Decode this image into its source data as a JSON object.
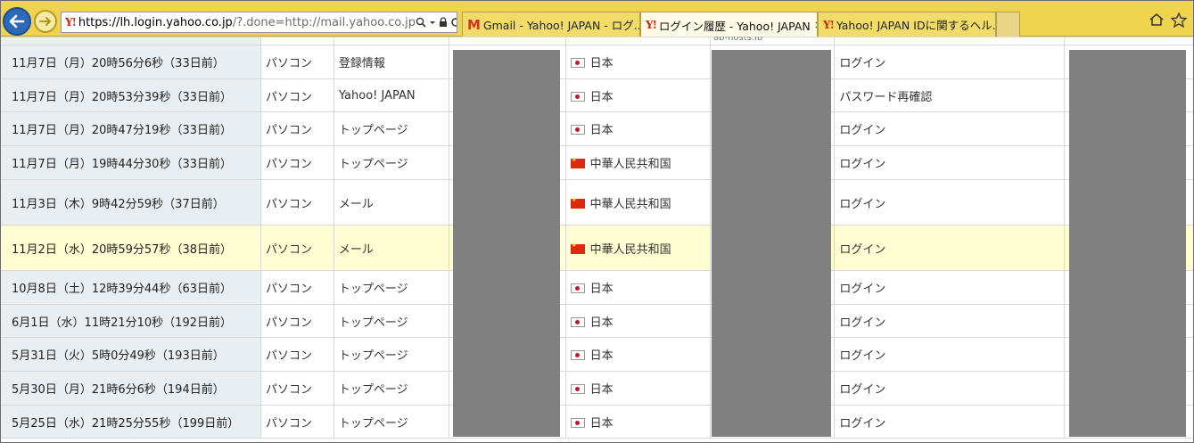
{
  "browser": {
    "address": {
      "host": "https://lh.login.yahoo.co.jp",
      "rest": "/?.done=http://mail.yahoo.co.jp",
      "logo": "Y!"
    },
    "tabs": [
      {
        "icon": "gmail-icon",
        "title": "Gmail - Yahoo! JAPAN - ログ...",
        "active": false
      },
      {
        "icon": "yahoo-icon",
        "logo": "Y!",
        "title": "ログイン履歴 - Yahoo! JAPAN",
        "active": true
      },
      {
        "icon": "yahoo-icon",
        "logo": "Y!",
        "title": "Yahoo! JAPAN IDに関するヘル...",
        "active": false
      }
    ],
    "tab_gmail_logo": "M",
    "close_glyph": "×"
  },
  "table": {
    "top_stray_text": "ab-hosts.jp",
    "rows": [
      {
        "date": "11月7日（月）20時56分6秒（33日前）",
        "device": "パソコン",
        "service": "登録情報",
        "country": "日本",
        "flag": "jp",
        "action": "ログイン",
        "highlight": false
      },
      {
        "date": "11月7日（月）20時53分39秒（33日前）",
        "device": "パソコン",
        "service": "Yahoo! JAPAN",
        "country": "日本",
        "flag": "jp",
        "action": "パスワード再確認",
        "highlight": false
      },
      {
        "date": "11月7日（月）20時47分19秒（33日前）",
        "device": "パソコン",
        "service": "トップページ",
        "country": "日本",
        "flag": "jp",
        "action": "ログイン",
        "highlight": false
      },
      {
        "date": "11月7日（月）19時44分30秒（33日前）",
        "device": "パソコン",
        "service": "トップページ",
        "country": "中華人民共和国",
        "flag": "cn",
        "action": "ログイン",
        "highlight": false
      },
      {
        "date": "11月3日（木）9時42分59秒（37日前）",
        "device": "パソコン",
        "service": "メール",
        "country": "中華人民共和国",
        "flag": "cn",
        "action": "ログイン",
        "highlight": false
      },
      {
        "date": "11月2日（水）20時59分57秒（38日前）",
        "device": "パソコン",
        "service": "メール",
        "country": "中華人民共和国",
        "flag": "cn",
        "action": "ログイン",
        "highlight": true
      },
      {
        "date": "10月8日（土）12時39分44秒（63日前）",
        "device": "パソコン",
        "service": "トップページ",
        "country": "日本",
        "flag": "jp",
        "action": "ログイン",
        "highlight": false
      },
      {
        "date": "6月1日（水）11時21分10秒（192日前）",
        "device": "パソコン",
        "service": "トップページ",
        "country": "日本",
        "flag": "jp",
        "action": "ログイン",
        "highlight": false
      },
      {
        "date": "5月31日（火）5時0分49秒（193日前）",
        "device": "パソコン",
        "service": "トップページ",
        "country": "日本",
        "flag": "jp",
        "action": "ログイン",
        "highlight": false
      },
      {
        "date": "5月30日（月）21時6分6秒（194日前）",
        "device": "パソコン",
        "service": "トップページ",
        "country": "日本",
        "flag": "jp",
        "action": "ログイン",
        "highlight": false
      },
      {
        "date": "5月25日（水）21時25分55秒（199日前）",
        "device": "パソコン",
        "service": "トップページ",
        "country": "日本",
        "flag": "jp",
        "action": "ログイン",
        "highlight": false
      }
    ]
  }
}
